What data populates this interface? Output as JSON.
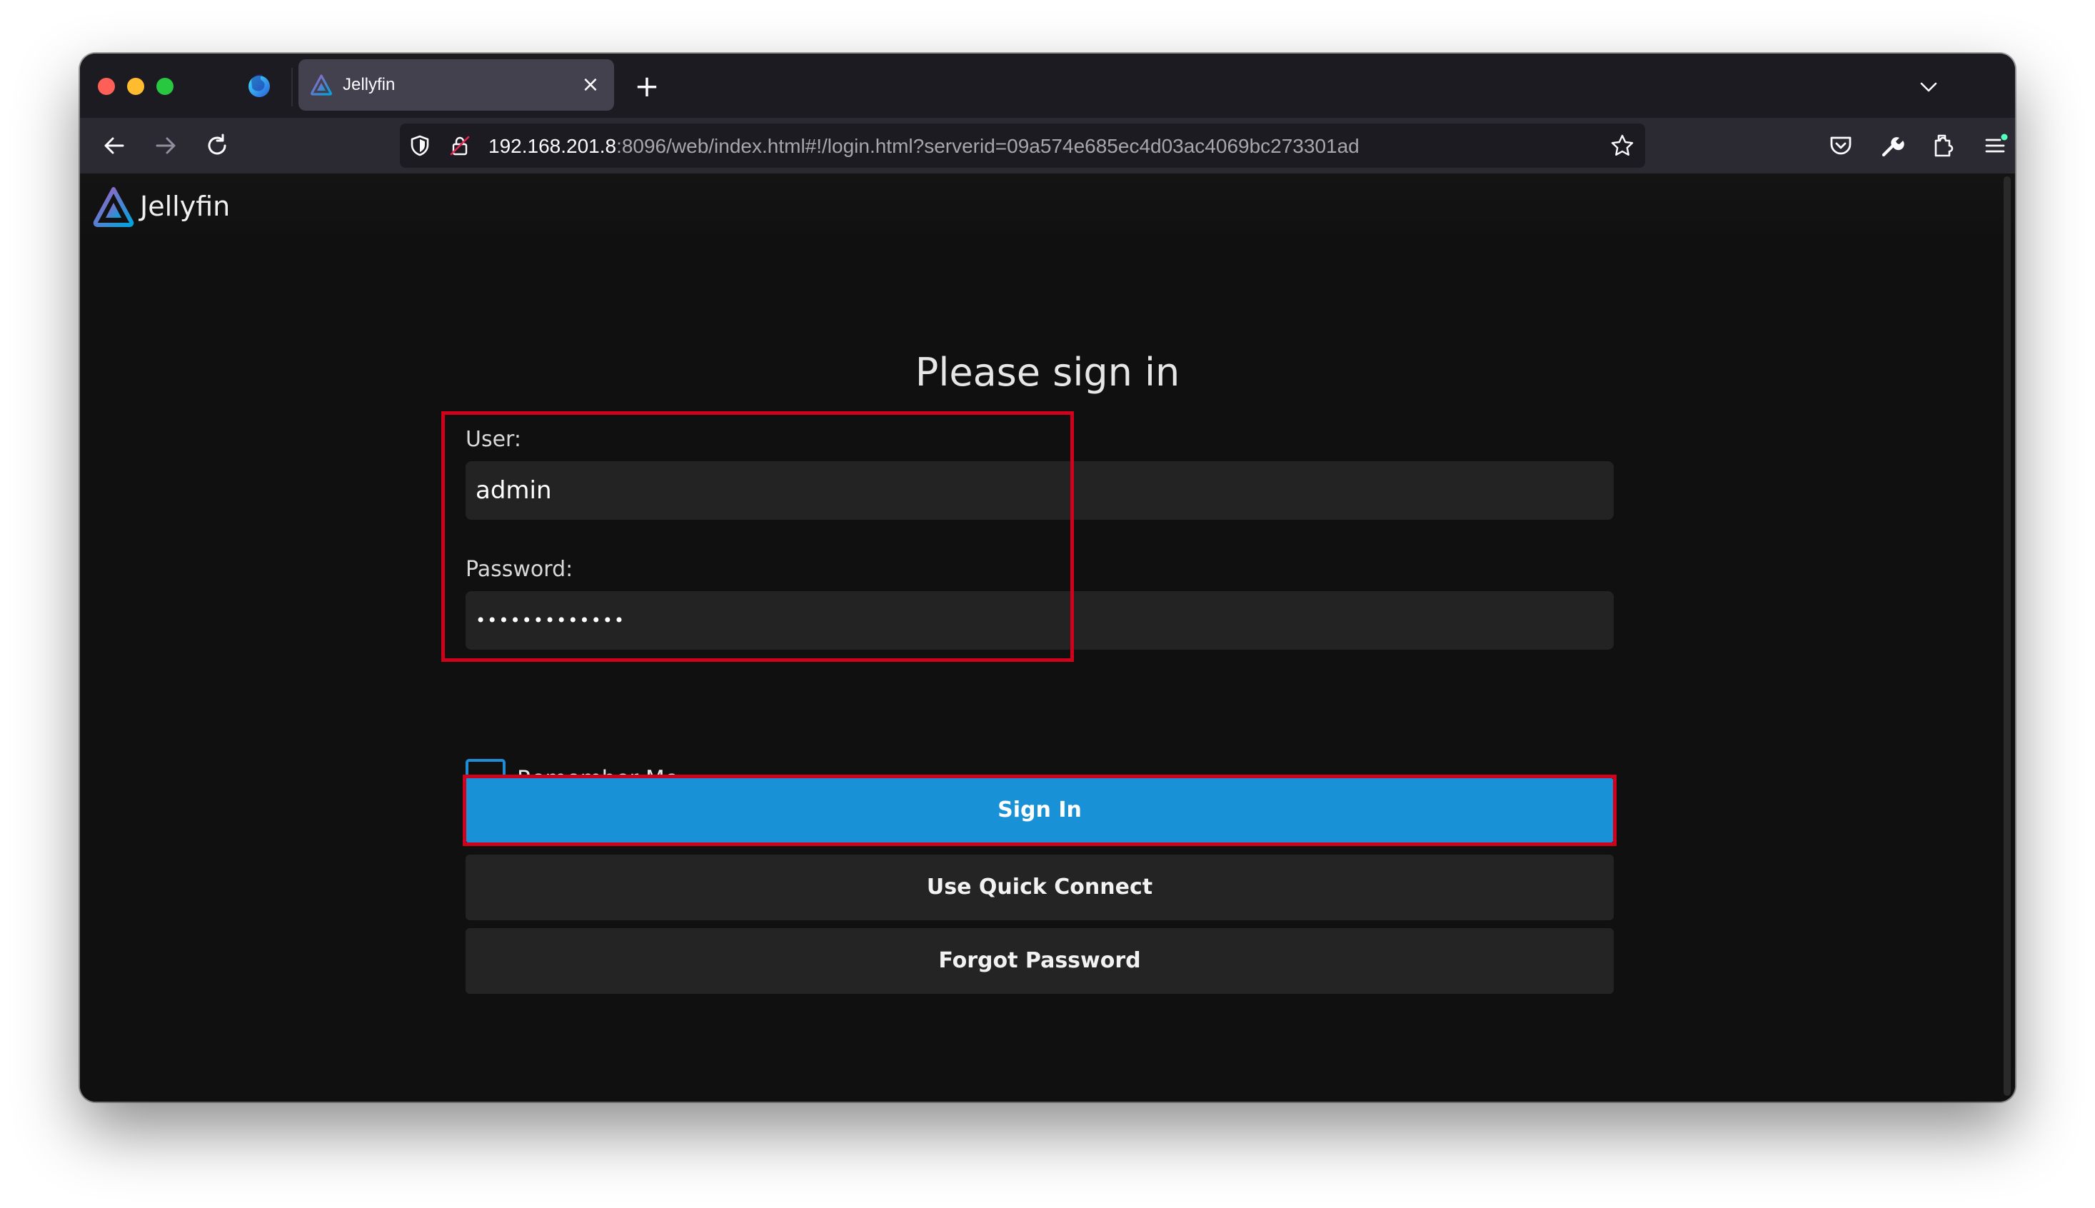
{
  "browser": {
    "tab": {
      "title": "Jellyfin"
    },
    "address": {
      "host": "192.168.201.8",
      "path": ":8096/web/index.html#!/login.html?serverid=09a574e685ec4d03ac4069bc273301ad"
    },
    "icons": {
      "firefox": "firefox-icon",
      "back": "back-arrow-icon",
      "forward": "forward-arrow-icon",
      "reload": "reload-icon",
      "shield": "tracking-protection-shield-icon",
      "lock": "insecure-lock-icon",
      "bookmark": "star-icon",
      "pocket": "pocket-icon",
      "tools": "wrench-icon",
      "extensions": "puzzle-icon",
      "menu": "hamburger-menu-icon"
    }
  },
  "app": {
    "name": "Jellyfin",
    "login": {
      "title": "Please sign in",
      "user_label": "User:",
      "user_value": "admin",
      "password_label": "Password:",
      "password_value": "•••••••••••••",
      "remember_label": "Remember Me",
      "remember_checked": false,
      "sign_in_label": "Sign In",
      "quick_connect_label": "Use Quick Connect",
      "forgot_password_label": "Forgot Password"
    }
  },
  "colors": {
    "accent": "#1891d6",
    "highlight": "#d0021b",
    "page_background": "#101010",
    "brand_purple": "#aa5cc3",
    "brand_blue": "#00a4dc"
  }
}
